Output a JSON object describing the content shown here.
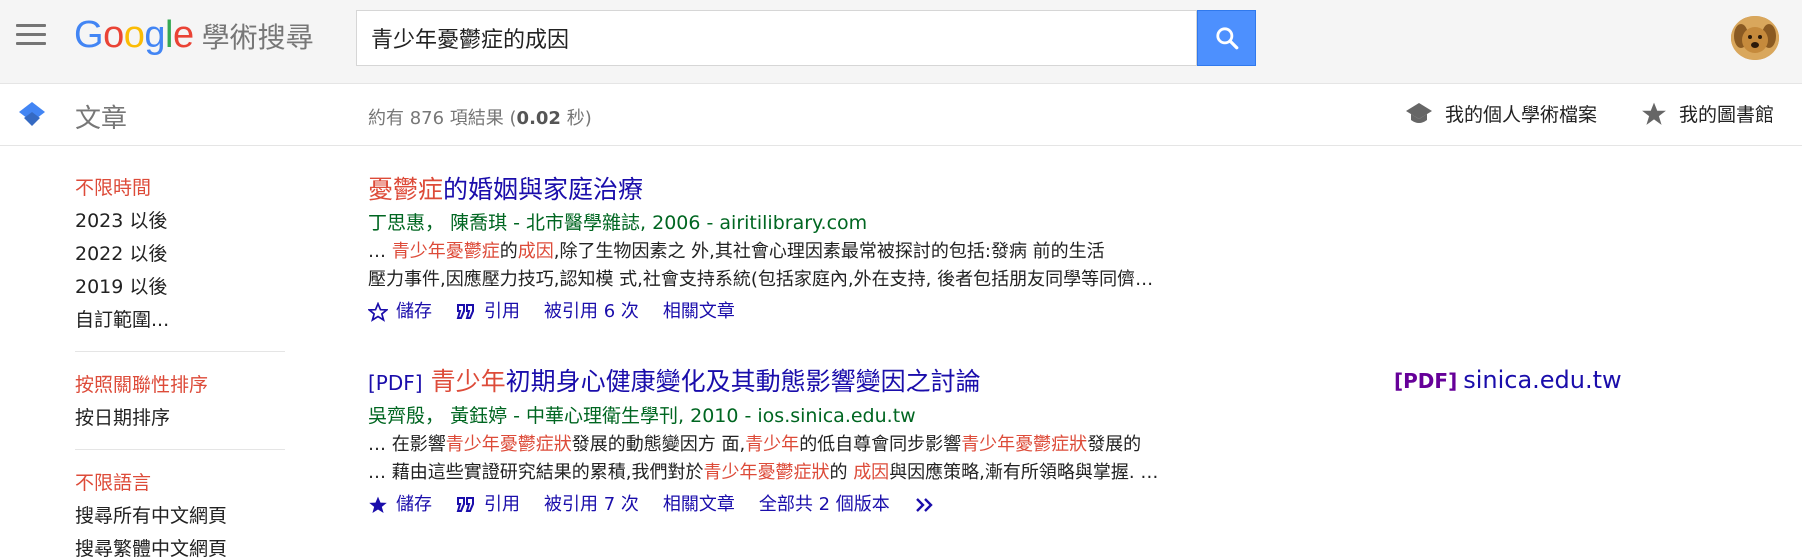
{
  "header": {
    "logo_letters": [
      "G",
      "o",
      "o",
      "g",
      "l",
      "e"
    ],
    "product_name": "學術搜尋",
    "search_value": "青少年憂鬱症的成因",
    "search_placeholder": ""
  },
  "subbar": {
    "section_title": "文章",
    "stats_prefix": "約有 876 項結果 (",
    "stats_time": "0.02",
    "stats_suffix": " 秒)",
    "profile_label": "我的個人學術檔案",
    "library_label": "我的圖書館"
  },
  "sidebar": {
    "time_items": [
      "不限時間",
      "2023 以後",
      "2022 以後",
      "2019 以後",
      "自訂範圍..."
    ],
    "sort_items": [
      "按照關聯性排序",
      "按日期排序"
    ],
    "lang_items": [
      "不限語言",
      "搜尋所有中文網頁",
      "搜尋繁體中文網頁"
    ]
  },
  "results": [
    {
      "title_hl": "憂鬱症",
      "title_rest": "的婚姻與家庭治療",
      "authors": [
        "丁思惠",
        "陳喬琪"
      ],
      "source": " - 北市醫學雜誌, 2006 - airitilibrary.com",
      "snippet1_pre": "… ",
      "snippet1_hl1": "青少年憂鬱症",
      "snippet1_mid": "的",
      "snippet1_hl2": "成因",
      "snippet1_post": ",除了生物因素之 外,其社會心理因素最常被探討的包括:發病 前的生活",
      "snippet2": "壓力事件,因應壓力技巧,認知模 式,社會支持系統(包括家庭內,外在支持, 後者包括朋友同學等同儕…",
      "save": "儲存",
      "cite": "引用",
      "cited_by": "被引用 6 次",
      "related": "相關文章"
    },
    {
      "pdf_tag": "[PDF]",
      "title_hl": "青少年",
      "title_rest": "初期身心健康變化及其動態影響變因之討論",
      "authors": [
        "吳齊殷",
        "黃鈺婷"
      ],
      "source": " - 中華心理衛生學刊, 2010 - ios.sinica.edu.tw",
      "snippet1_a": "… 在影響",
      "snippet1_b": "青少年憂鬱症狀",
      "snippet1_c": "發展的動態變因方 面,",
      "snippet1_d": "青少年",
      "snippet1_e": "的低自尊會同步影響",
      "snippet1_f": "青少年憂鬱症狀",
      "snippet1_g": "發展的",
      "snippet2_a": "… 藉由這些實證研究結果的累積,我們對於",
      "snippet2_b": "青少年憂鬱症狀",
      "snippet2_c": "的 ",
      "snippet2_d": "成因",
      "snippet2_e": "與因應策略,漸有所領略與掌握. …",
      "save": "儲存",
      "cite": "引用",
      "cited_by": "被引用 7 次",
      "related": "相關文章",
      "versions": "全部共 2 個版本",
      "side_pdf_tag": "[PDF]",
      "side_pdf_domain": "sinica.edu.tw"
    }
  ],
  "colors": {
    "highlight": "#dd4b39",
    "link": "#1a0dab",
    "meta_green": "#006621",
    "search_button": "#4d90fe"
  },
  "icons": {
    "menu": "hamburger-menu-icon",
    "search": "search-icon",
    "scholar_cap": "scholar-cap-icon",
    "profile": "graduation-cap-icon",
    "library": "star-icon",
    "save_empty": "star-outline-icon",
    "save_filled": "star-filled-icon",
    "cite": "quote-icon",
    "more": "double-chevron-icon"
  }
}
